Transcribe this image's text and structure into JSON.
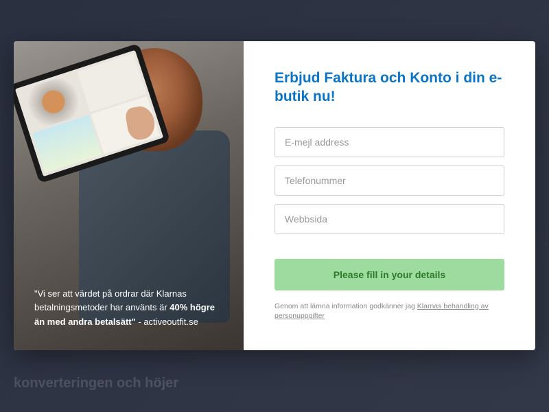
{
  "backdrop": {
    "text_fragment": "konverteringen och höjer"
  },
  "testimonial": {
    "quote_pre": "\"Vi ser att värdet på ordrar där Klarnas betalningsmetoder har använts är ",
    "quote_bold": "40% högre än med andra betalsätt\"",
    "attribution": " - activeoutfit.se"
  },
  "form": {
    "title": "Erbjud Faktura och Konto i din e-butik nu!",
    "email_placeholder": "E-mejl address",
    "phone_placeholder": "Telefonummer",
    "website_placeholder": "Webbsida",
    "submit_label": "Please fill in your details",
    "consent_text": "Genom att lämna information godkänner jag ",
    "consent_link": "Klarnas behandling av personuppgifter"
  }
}
